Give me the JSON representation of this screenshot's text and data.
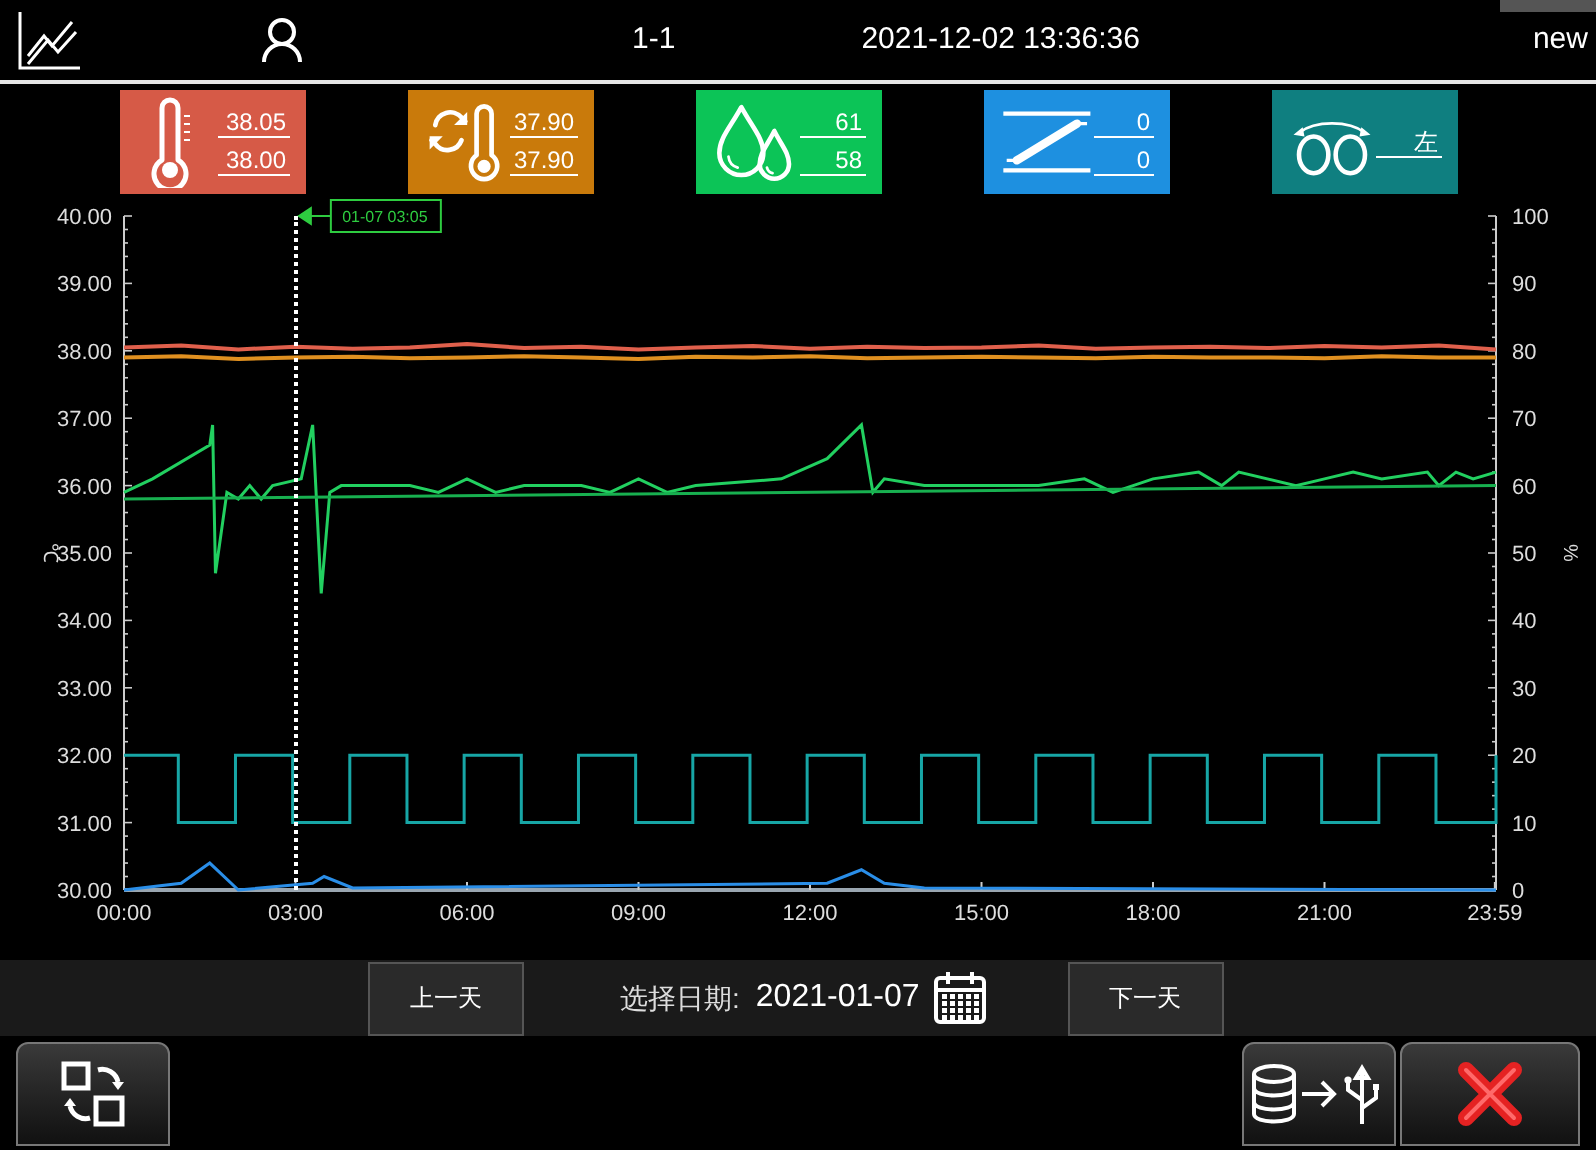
{
  "header": {
    "station": "1-1",
    "datetime": "2021-12-02 13:36:36",
    "mode": "new"
  },
  "cards": [
    {
      "kind": "temperature",
      "color": "#d65a47",
      "readings": [
        "38.05",
        "38.00"
      ]
    },
    {
      "kind": "cycle-temperature",
      "color": "#c97a0b",
      "readings": [
        "37.90",
        "37.90"
      ]
    },
    {
      "kind": "humidity",
      "color": "#0cc457",
      "readings": [
        "61",
        "58"
      ]
    },
    {
      "kind": "damper",
      "color": "#1e90e0",
      "readings": [
        "0",
        "0"
      ]
    },
    {
      "kind": "turning",
      "color": "#0f7f80",
      "readings": [
        "左"
      ]
    }
  ],
  "chart_data": {
    "type": "line",
    "ylabel": "℃",
    "y2label": "%",
    "ylim": [
      30,
      40
    ],
    "y2lim": [
      0,
      100
    ],
    "xlim": [
      0,
      24
    ],
    "yticks": [
      {
        "value": 30,
        "label": "30.00"
      },
      {
        "value": 31,
        "label": "31.00"
      },
      {
        "value": 32,
        "label": "32.00"
      },
      {
        "value": 33,
        "label": "33.00"
      },
      {
        "value": 34,
        "label": "34.00"
      },
      {
        "value": 35,
        "label": "35.00"
      },
      {
        "value": 36,
        "label": "36.00"
      },
      {
        "value": 37,
        "label": "37.00"
      },
      {
        "value": 38,
        "label": "38.00"
      },
      {
        "value": 39,
        "label": "39.00"
      },
      {
        "value": 40,
        "label": "40.00"
      }
    ],
    "y2ticks": [
      0,
      10,
      20,
      30,
      40,
      50,
      60,
      70,
      80,
      90,
      100
    ],
    "xticks": [
      {
        "value": 0,
        "label": "00:00"
      },
      {
        "value": 3,
        "label": "03:00"
      },
      {
        "value": 6,
        "label": "06:00"
      },
      {
        "value": 9,
        "label": "09:00"
      },
      {
        "value": 12,
        "label": "12:00"
      },
      {
        "value": 15,
        "label": "15:00"
      },
      {
        "value": 18,
        "label": "18:00"
      },
      {
        "value": 21,
        "label": "21:00"
      },
      {
        "value": 23.98,
        "label": "23:59"
      }
    ],
    "series": [
      {
        "color": "#e0604c",
        "x": [
          0,
          1,
          2,
          3,
          4,
          5,
          6,
          7,
          8,
          9,
          10,
          11,
          12,
          13,
          14,
          15,
          16,
          17,
          18,
          19,
          20,
          21,
          22,
          23,
          24
        ],
        "values": [
          38.05,
          38.08,
          38.02,
          38.06,
          38.03,
          38.05,
          38.1,
          38.04,
          38.06,
          38.02,
          38.05,
          38.07,
          38.03,
          38.06,
          38.04,
          38.05,
          38.08,
          38.03,
          38.05,
          38.06,
          38.04,
          38.07,
          38.05,
          38.08,
          38.02
        ]
      },
      {
        "color": "#e09020",
        "x": [
          0,
          1,
          2,
          3,
          4,
          5,
          6,
          7,
          8,
          9,
          10,
          11,
          12,
          13,
          14,
          15,
          16,
          17,
          18,
          19,
          20,
          21,
          22,
          23,
          24
        ],
        "values": [
          37.9,
          37.92,
          37.88,
          37.9,
          37.91,
          37.89,
          37.9,
          37.92,
          37.9,
          37.88,
          37.91,
          37.9,
          37.92,
          37.89,
          37.9,
          37.91,
          37.9,
          37.89,
          37.91,
          37.9,
          37.9,
          37.89,
          37.92,
          37.9,
          37.9
        ]
      },
      {
        "color": "#22d060",
        "axis": "y2",
        "x": [
          0,
          0.5,
          1.5,
          1.55,
          1.6,
          1.8,
          2.0,
          2.2,
          2.4,
          2.6,
          3.1,
          3.3,
          3.45,
          3.6,
          3.8,
          5,
          5.5,
          6,
          6.5,
          7,
          8,
          8.5,
          9,
          9.5,
          10,
          11.5,
          12.3,
          12.9,
          13.1,
          13.3,
          14,
          15,
          16,
          16.8,
          17.3,
          18,
          18.8,
          19.2,
          19.5,
          20.5,
          21,
          21.5,
          22,
          22.8,
          23,
          23.3,
          23.6,
          24
        ],
        "values": [
          59,
          61,
          66,
          69,
          47,
          59,
          58,
          60,
          58,
          60,
          61,
          69,
          44,
          59,
          60,
          60,
          59,
          61,
          59,
          60,
          60,
          59,
          61,
          59,
          60,
          61,
          64,
          69,
          59,
          61,
          60,
          60,
          60,
          61,
          59,
          61,
          62,
          60,
          62,
          60,
          61,
          62,
          61,
          62,
          60,
          62,
          61,
          62
        ]
      },
      {
        "color": "#18b050",
        "axis": "y2",
        "x": [
          0,
          24
        ],
        "values": [
          58,
          60
        ]
      },
      {
        "color": "#17a6a6",
        "axis": "y2",
        "x": [
          0,
          0.95,
          0.95,
          1.95,
          1.95,
          2.95,
          2.95,
          3.95,
          3.95,
          4.95,
          4.95,
          5.95,
          5.95,
          6.95,
          6.95,
          7.95,
          7.95,
          8.95,
          8.95,
          9.95,
          9.95,
          10.95,
          10.95,
          11.95,
          11.95,
          12.95,
          12.95,
          13.95,
          13.95,
          14.95,
          14.95,
          15.95,
          15.95,
          16.95,
          16.95,
          17.95,
          17.95,
          18.95,
          18.95,
          19.95,
          19.95,
          20.95,
          20.95,
          21.95,
          21.95,
          22.95,
          22.95,
          24,
          24
        ],
        "values": [
          20,
          20,
          10,
          10,
          20,
          20,
          10,
          10,
          20,
          20,
          10,
          10,
          20,
          20,
          10,
          10,
          20,
          20,
          10,
          10,
          20,
          20,
          10,
          10,
          20,
          20,
          10,
          10,
          20,
          20,
          10,
          10,
          20,
          20,
          10,
          10,
          20,
          20,
          10,
          10,
          20,
          20,
          10,
          10,
          20,
          20,
          10,
          10,
          20
        ]
      },
      {
        "color": "#2a8ee8",
        "axis": "y2",
        "x": [
          0,
          1,
          1.5,
          2,
          3.3,
          3.5,
          4,
          12.3,
          12.9,
          13.3,
          14,
          24
        ],
        "values": [
          0,
          1,
          4,
          0,
          1,
          2,
          0.3,
          1,
          3,
          1,
          0.3,
          0
        ]
      }
    ],
    "annotations": [
      "01-07 03:05"
    ]
  },
  "cursor": {
    "level": 0.186
  },
  "date_bar": {
    "prev": "上一天",
    "label": "选择日期:",
    "date": "2021-01-07",
    "next": "下一天"
  }
}
